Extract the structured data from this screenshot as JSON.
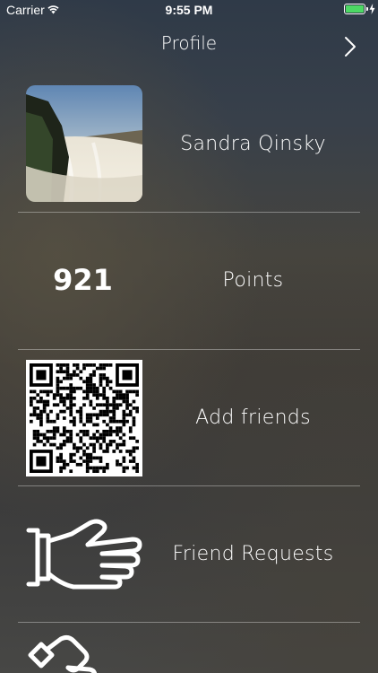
{
  "status_bar": {
    "carrier": "Carrier",
    "time": "9:55 PM",
    "wifi_icon": "wifi-icon",
    "battery_icon": "battery-icon",
    "battery_color": "#4cd964",
    "charging_icon": "charging-bolt-icon"
  },
  "nav": {
    "title": "Profile",
    "forward_icon": "chevron-right-icon"
  },
  "profile": {
    "name": "Sandra Qinsky",
    "avatar_icon": "waterfall-photo"
  },
  "points": {
    "value": "921",
    "label": "Points"
  },
  "friends": {
    "label": "Add friends",
    "qr_icon": "qr-code-icon"
  },
  "requests": {
    "label": "Friend Requests",
    "icon": "handshake-hand-icon"
  },
  "partial_row": {
    "icon": "hand-icon"
  },
  "colors": {
    "text": "#ffffff",
    "divider": "rgba(255,255,255,0.35)",
    "background_top": "#2f3a48",
    "background_bottom": "#474745"
  }
}
